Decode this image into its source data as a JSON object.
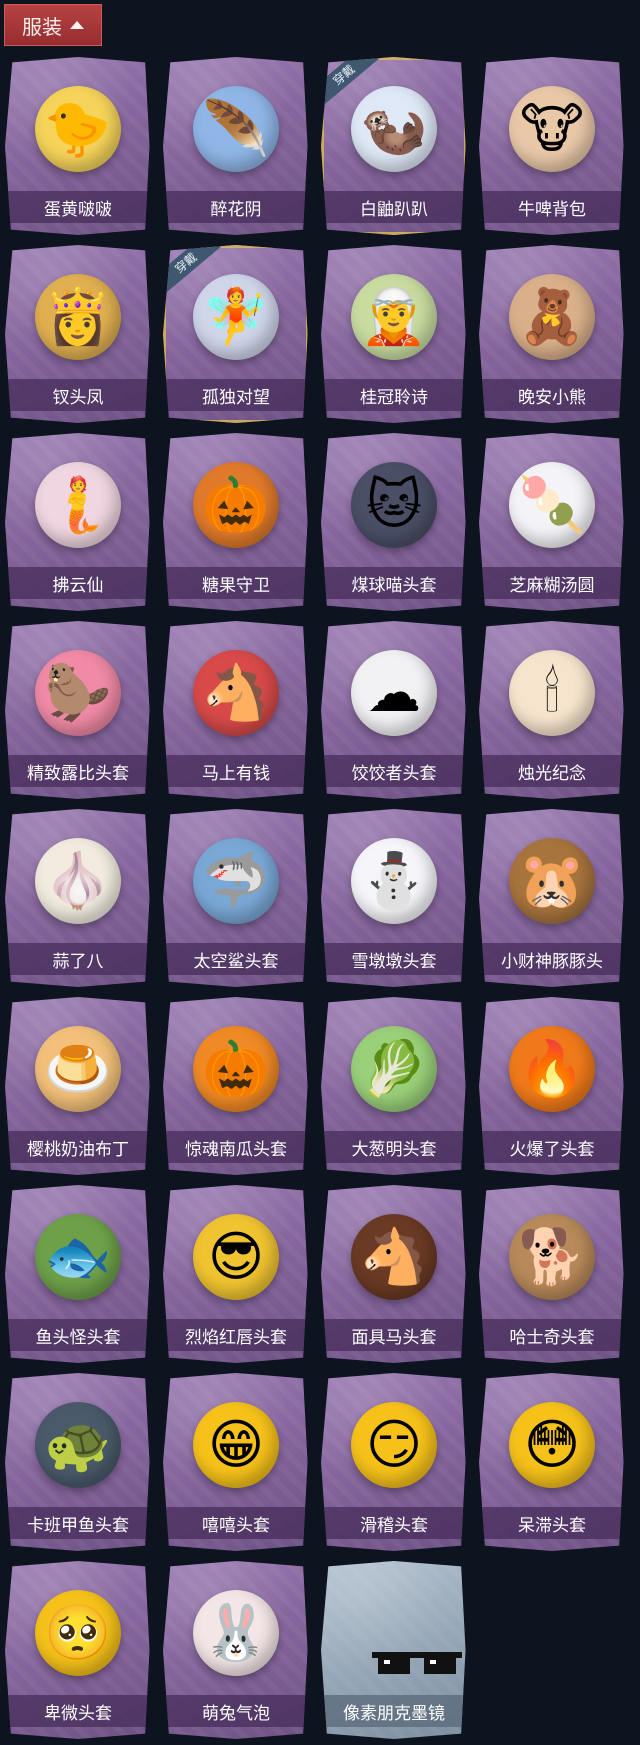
{
  "header": {
    "title": "服装"
  },
  "badge_label": "穿戴",
  "items": [
    {
      "name": "蛋黄啵啵",
      "icon": "chick-egg-icon",
      "glyph": "🐤",
      "color": "#f6d45a"
    },
    {
      "name": "醉花阴",
      "icon": "dreamcatcher-icon",
      "glyph": "🪶",
      "color": "#8fb6e6"
    },
    {
      "name": "白鼬趴趴",
      "icon": "white-ferret-icon",
      "glyph": "🦦",
      "color": "#dfe8f6",
      "equipped": true
    },
    {
      "name": "牛啤背包",
      "icon": "cow-beer-icon",
      "glyph": "🐮",
      "color": "#e9c8a8"
    },
    {
      "name": "钗头凤",
      "icon": "phoenix-crown-doll-icon",
      "glyph": "👸",
      "color": "#e0b050"
    },
    {
      "name": "孤独对望",
      "icon": "white-hair-doll-icon",
      "glyph": "🧚",
      "color": "#cfd6ea",
      "equipped": true
    },
    {
      "name": "桂冠聆诗",
      "icon": "laurel-doll-icon",
      "glyph": "🧝",
      "color": "#c8dca0"
    },
    {
      "name": "晚安小熊",
      "icon": "teddy-bear-icon",
      "glyph": "🧸",
      "color": "#d9b08a"
    },
    {
      "name": "拂云仙",
      "icon": "cloud-fairy-icon",
      "glyph": "🧜",
      "color": "#f0d6e0"
    },
    {
      "name": "糖果守卫",
      "icon": "pumpkin-guard-icon",
      "glyph": "🎃",
      "color": "#e07a2a"
    },
    {
      "name": "煤球喵头套",
      "icon": "black-cat-head-icon",
      "glyph": "🐱",
      "color": "#4a4f66"
    },
    {
      "name": "芝麻糊汤圆",
      "icon": "rice-ball-icon",
      "glyph": "🍡",
      "color": "#f4f4f8"
    },
    {
      "name": "精致露比头套",
      "icon": "pink-beaver-head-icon",
      "glyph": "🦫",
      "color": "#f08aa6"
    },
    {
      "name": "马上有钱",
      "icon": "red-horse-head-icon",
      "glyph": "🐴",
      "color": "#d84a4a"
    },
    {
      "name": "饺饺者头套",
      "icon": "cloud-dumpling-head-icon",
      "glyph": "☁",
      "color": "#f2f2f4"
    },
    {
      "name": "烛光纪念",
      "icon": "candle-head-icon",
      "glyph": "🕯",
      "color": "#f6e4cc"
    },
    {
      "name": "蒜了八",
      "icon": "garlic-head-icon",
      "glyph": "🧄",
      "color": "#f2ece0"
    },
    {
      "name": "太空鲨头套",
      "icon": "shark-head-icon",
      "glyph": "🦈",
      "color": "#7aa8d6"
    },
    {
      "name": "雪墩墩头套",
      "icon": "snowman-head-icon",
      "glyph": "⛄",
      "color": "#f6f6fa"
    },
    {
      "name": "小财神豚豚头",
      "icon": "capybara-head-icon",
      "glyph": "🐹",
      "color": "#a8743e"
    },
    {
      "name": "樱桃奶油布丁",
      "icon": "pudding-head-icon",
      "glyph": "🍮",
      "color": "#f2c07a"
    },
    {
      "name": "惊魂南瓜头套",
      "icon": "pumpkin-head-icon",
      "glyph": "🎃",
      "color": "#f08a24"
    },
    {
      "name": "大葱明头套",
      "icon": "scallion-head-icon",
      "glyph": "🥬",
      "color": "#9ad07a"
    },
    {
      "name": "火爆了头套",
      "icon": "fire-head-icon",
      "glyph": "🔥",
      "color": "#f07a1a"
    },
    {
      "name": "鱼头怪头套",
      "icon": "fish-head-icon",
      "glyph": "🐟",
      "color": "#6ea04a"
    },
    {
      "name": "烈焰红唇头套",
      "icon": "pikachu-sunglasses-head-icon",
      "glyph": "😎",
      "color": "#f0c430"
    },
    {
      "name": "面具马头套",
      "icon": "horse-mask-head-icon",
      "glyph": "🐴",
      "color": "#6a3a24"
    },
    {
      "name": "哈士奇头套",
      "icon": "husky-head-icon",
      "glyph": "🐕",
      "color": "#b88a5a"
    },
    {
      "name": "卡班甲鱼头套",
      "icon": "turtle-head-icon",
      "glyph": "🐢",
      "color": "#4a5a6a"
    },
    {
      "name": "嘻嘻头套",
      "icon": "grin-emoji-head-icon",
      "glyph": "😁",
      "color": "#f6c21a"
    },
    {
      "name": "滑稽头套",
      "icon": "smirk-emoji-head-icon",
      "glyph": "😏",
      "color": "#f6c21a"
    },
    {
      "name": "呆滞头套",
      "icon": "stare-emoji-head-icon",
      "glyph": "😳",
      "color": "#f6c21a"
    },
    {
      "name": "卑微头套",
      "icon": "humble-emoji-head-icon",
      "glyph": "🥺",
      "color": "#f6c21a"
    },
    {
      "name": "萌兔气泡",
      "icon": "bunny-bubble-icon",
      "glyph": "🐰",
      "color": "#f4e6e6"
    },
    {
      "name": "像素朋克墨镜",
      "icon": "pixel-sunglasses-icon",
      "glyph": "",
      "color": "#111111",
      "locked": true
    }
  ]
}
